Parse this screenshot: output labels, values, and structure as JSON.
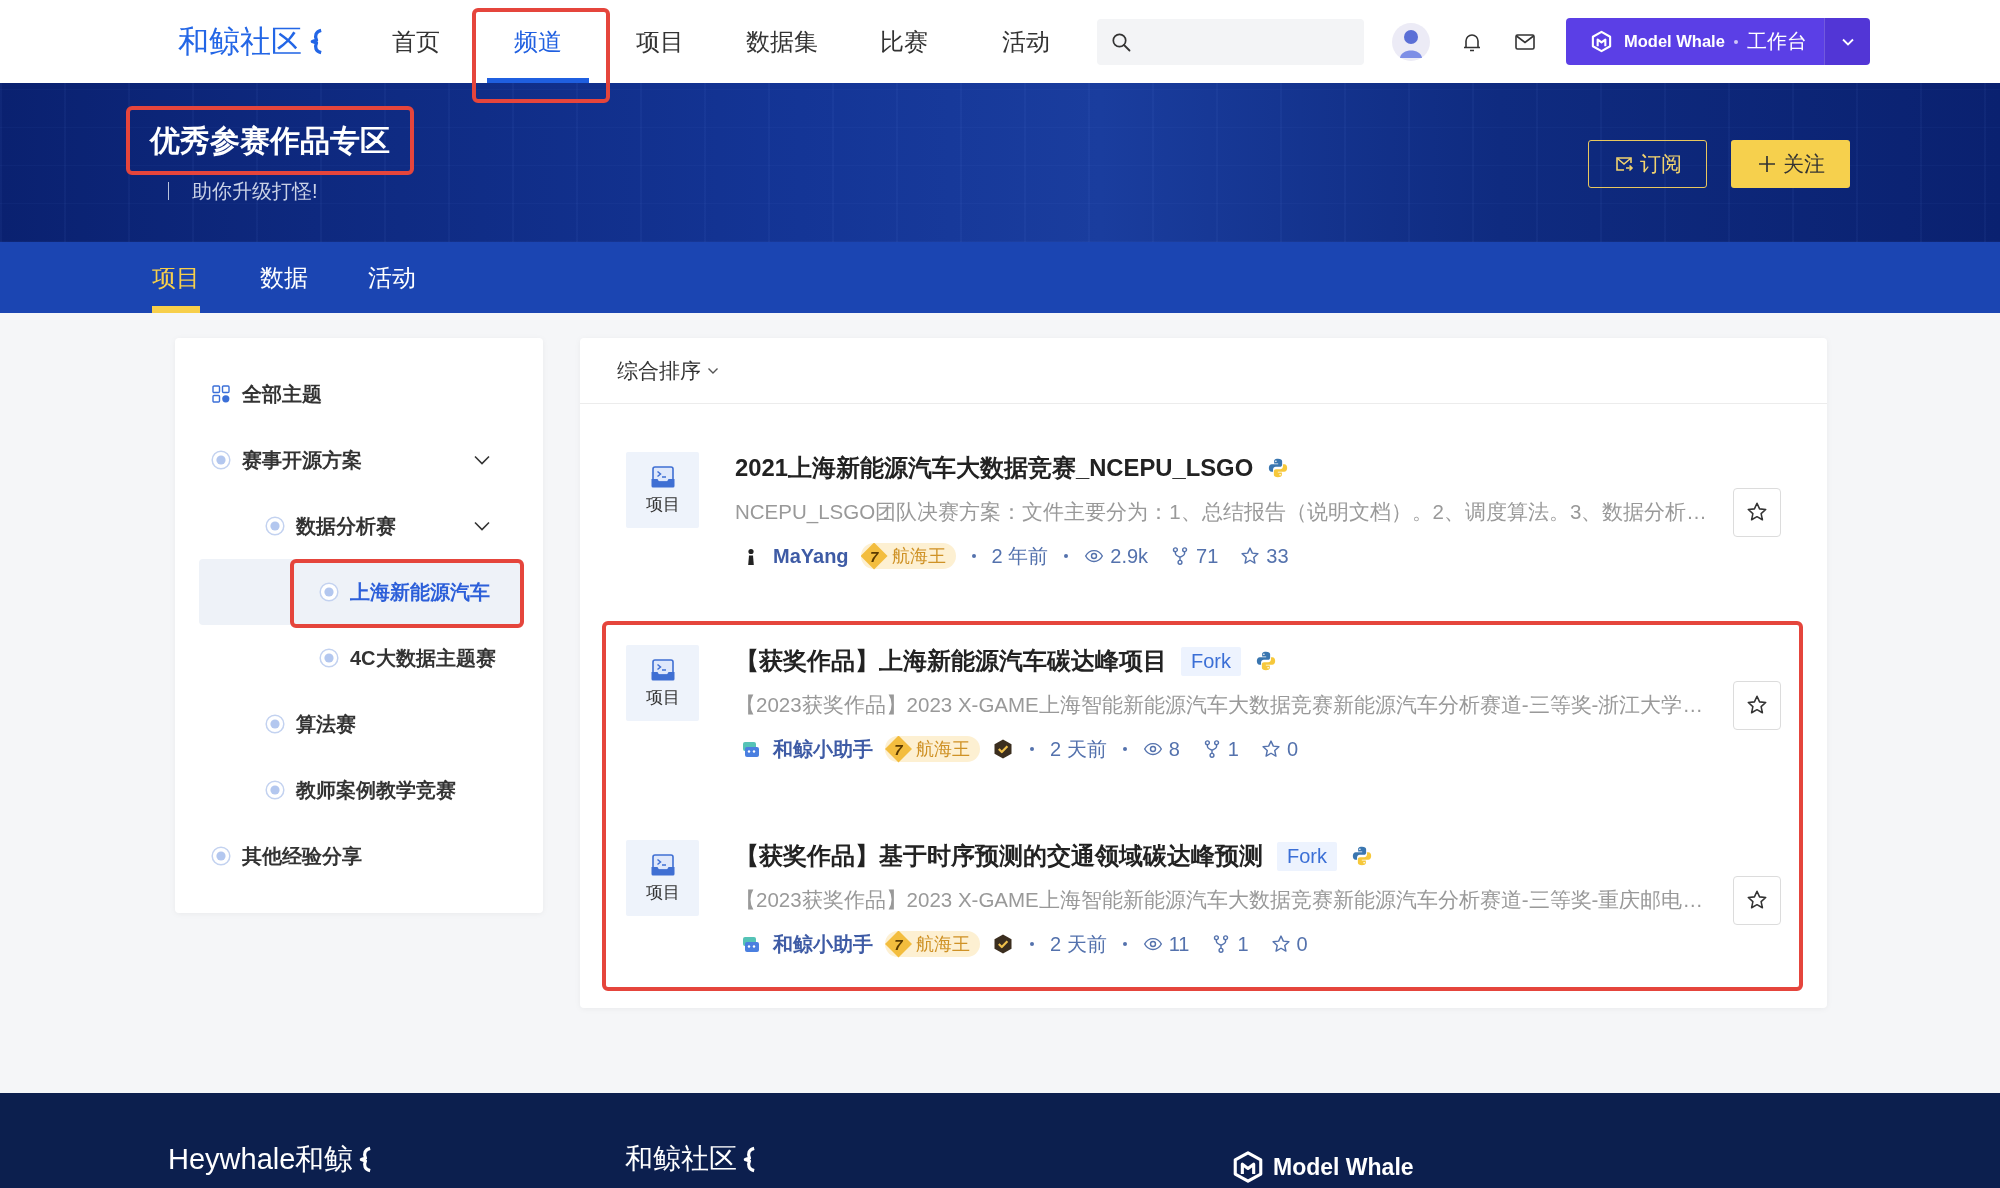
{
  "nav": {
    "logo": "和鲸社区",
    "items": [
      {
        "label": "首页",
        "selected": false,
        "highlighted": false
      },
      {
        "label": "频道",
        "selected": true,
        "highlighted": true
      },
      {
        "label": "项目",
        "selected": false,
        "highlighted": false
      },
      {
        "label": "数据集",
        "selected": false,
        "highlighted": false
      },
      {
        "label": "比赛",
        "selected": false,
        "highlighted": false
      },
      {
        "label": "活动",
        "selected": false,
        "highlighted": false
      }
    ],
    "workbench": {
      "brand": "Model Whale",
      "label": "工作台"
    }
  },
  "banner": {
    "title": "优秀参赛作品专区",
    "highlighted": true,
    "subtitle": "助你升级打怪!",
    "buttons": [
      {
        "kind": "subscribe",
        "label": "订阅"
      },
      {
        "kind": "follow",
        "label": "关注"
      }
    ]
  },
  "tabs": [
    {
      "label": "项目",
      "selected": true
    },
    {
      "label": "数据",
      "selected": false
    },
    {
      "label": "活动",
      "selected": false
    }
  ],
  "sidebar": {
    "items": [
      {
        "kind": "all",
        "label": "全部主题",
        "selected": false,
        "highlighted": false
      },
      {
        "kind": "topic",
        "label": "赛事开源方案",
        "selected": false,
        "highlighted": false,
        "expanded": true,
        "children": [
          {
            "kind": "topic",
            "label": "数据分析赛",
            "selected": false,
            "highlighted": false,
            "expanded": true,
            "children": [
              {
                "kind": "topic",
                "label": "上海新能源汽车",
                "selected": true,
                "highlighted": true
              },
              {
                "kind": "topic",
                "label": "4C大数据主题赛",
                "selected": false,
                "highlighted": false
              }
            ]
          },
          {
            "kind": "topic",
            "label": "算法赛",
            "selected": false,
            "highlighted": false
          },
          {
            "kind": "topic",
            "label": "教师案例教学竞赛",
            "selected": false,
            "highlighted": false
          }
        ]
      },
      {
        "kind": "topic",
        "label": "其他经验分享",
        "selected": false,
        "highlighted": false
      }
    ]
  },
  "feed": {
    "sort": "综合排序",
    "projects": [
      {
        "category": "项目",
        "title": "2021上海新能源汽车大数据竞赛_NCEPU_LSGO",
        "description": "NCEPU_LSGO团队决赛方案：文件主要分为：1、总结报告（说明文档）。2、调度算法。3、数据分析…",
        "author": {
          "kind": "person",
          "name": "MaYang"
        },
        "rank": "7",
        "rank_title": "航海王",
        "verified": false,
        "time": "2 年前",
        "views": "2.9k",
        "forks": "71",
        "favorites": "33",
        "highlighted": false
      },
      {
        "category": "项目",
        "title": "【获奖作品】上海新能源汽车碳达峰项目",
        "tags": [
          "Fork"
        ],
        "description": "【2023获奖作品】2023 X-GAME上海智能新能源汽车大数据竞赛新能源汽车分析赛道-三等奖-浙江大学…",
        "author": {
          "kind": "assistant",
          "name": "和鲸小助手"
        },
        "rank": "7",
        "rank_title": "航海王",
        "verified": true,
        "time": "2 天前",
        "views": "8",
        "forks": "1",
        "favorites": "0",
        "highlighted": true
      },
      {
        "category": "项目",
        "title": "【获奖作品】基于时序预测的交通领域碳达峰预测",
        "tags": [
          "Fork"
        ],
        "description": "【2023获奖作品】2023 X-GAME上海智能新能源汽车大数据竞赛新能源汽车分析赛道-三等奖-重庆邮电…",
        "author": {
          "kind": "assistant",
          "name": "和鲸小助手"
        },
        "rank": "7",
        "rank_title": "航海王",
        "verified": true,
        "time": "2 天前",
        "views": "11",
        "forks": "1",
        "favorites": "0",
        "highlighted": true
      }
    ]
  },
  "footer": {
    "brands": [
      {
        "kind": "heywhale",
        "label": "Heywhale和鲸"
      },
      {
        "kind": "community",
        "label": "和鲸社区"
      },
      {
        "kind": "modelwhale",
        "label": "Model Whale"
      }
    ]
  }
}
